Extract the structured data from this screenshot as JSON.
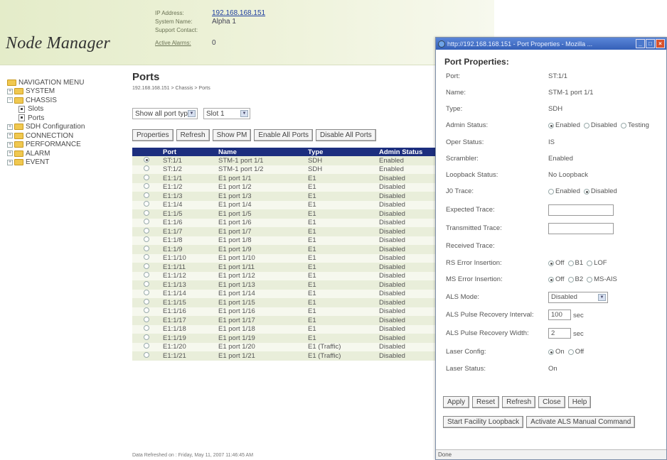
{
  "header": {
    "logo": "Node Manager",
    "ip_label": "IP Address:",
    "ip_value": "192.168.168.151",
    "sysname_label": "System Name:",
    "sysname_value": "Alpha 1",
    "support_label": "Support Contact:",
    "support_value": "",
    "alarms_label": "Active Alarms:",
    "alarms_value": "0"
  },
  "nav": {
    "items": [
      {
        "label": "NAVIGATION MENU"
      },
      {
        "label": "SYSTEM"
      },
      {
        "label": "CHASSIS"
      },
      {
        "label": "Slots"
      },
      {
        "label": "Ports"
      },
      {
        "label": "SDH Configuration"
      },
      {
        "label": "CONNECTION"
      },
      {
        "label": "PERFORMANCE"
      },
      {
        "label": "ALARM"
      },
      {
        "label": "EVENT"
      }
    ]
  },
  "main": {
    "title": "Ports",
    "breadcrumb": "192.168.168.151 > Chassis > Ports",
    "filter_porttype": "Show all port types",
    "filter_slot": "Slot 1",
    "buttons": {
      "properties": "Properties",
      "refresh": "Refresh",
      "show_pm": "Show PM",
      "enable_all": "Enable All Ports",
      "disable_all": "Disable All Ports"
    },
    "table": {
      "columns": [
        "",
        "Port",
        "Name",
        "Type",
        "Admin Status"
      ],
      "rows": [
        {
          "port": "ST:1/1",
          "name": "STM-1 port 1/1",
          "type": "SDH",
          "status": "Enabled",
          "selected": true
        },
        {
          "port": "ST:1/2",
          "name": "STM-1 port 1/2",
          "type": "SDH",
          "status": "Enabled"
        },
        {
          "port": "E1:1/1",
          "name": "E1 port 1/1",
          "type": "E1",
          "status": "Disabled"
        },
        {
          "port": "E1:1/2",
          "name": "E1 port 1/2",
          "type": "E1",
          "status": "Disabled"
        },
        {
          "port": "E1:1/3",
          "name": "E1 port 1/3",
          "type": "E1",
          "status": "Disabled"
        },
        {
          "port": "E1:1/4",
          "name": "E1 port 1/4",
          "type": "E1",
          "status": "Disabled"
        },
        {
          "port": "E1:1/5",
          "name": "E1 port 1/5",
          "type": "E1",
          "status": "Disabled"
        },
        {
          "port": "E1:1/6",
          "name": "E1 port 1/6",
          "type": "E1",
          "status": "Disabled"
        },
        {
          "port": "E1:1/7",
          "name": "E1 port 1/7",
          "type": "E1",
          "status": "Disabled"
        },
        {
          "port": "E1:1/8",
          "name": "E1 port 1/8",
          "type": "E1",
          "status": "Disabled"
        },
        {
          "port": "E1:1/9",
          "name": "E1 port 1/9",
          "type": "E1",
          "status": "Disabled"
        },
        {
          "port": "E1:1/10",
          "name": "E1 port 1/10",
          "type": "E1",
          "status": "Disabled"
        },
        {
          "port": "E1:1/11",
          "name": "E1 port 1/11",
          "type": "E1",
          "status": "Disabled"
        },
        {
          "port": "E1:1/12",
          "name": "E1 port 1/12",
          "type": "E1",
          "status": "Disabled"
        },
        {
          "port": "E1:1/13",
          "name": "E1 port 1/13",
          "type": "E1",
          "status": "Disabled"
        },
        {
          "port": "E1:1/14",
          "name": "E1 port 1/14",
          "type": "E1",
          "status": "Disabled"
        },
        {
          "port": "E1:1/15",
          "name": "E1 port 1/15",
          "type": "E1",
          "status": "Disabled"
        },
        {
          "port": "E1:1/16",
          "name": "E1 port 1/16",
          "type": "E1",
          "status": "Disabled"
        },
        {
          "port": "E1:1/17",
          "name": "E1 port 1/17",
          "type": "E1",
          "status": "Disabled"
        },
        {
          "port": "E1:1/18",
          "name": "E1 port 1/18",
          "type": "E1",
          "status": "Disabled"
        },
        {
          "port": "E1:1/19",
          "name": "E1 port 1/19",
          "type": "E1",
          "status": "Disabled"
        },
        {
          "port": "E1:1/20",
          "name": "E1 port 1/20",
          "type": "E1 (Traffic)",
          "status": "Disabled"
        },
        {
          "port": "E1:1/21",
          "name": "E1 port 1/21",
          "type": "E1 (Traffic)",
          "status": "Disabled"
        }
      ]
    },
    "refreshed": "Data Refreshed on : Friday, May 11, 2007 11:46:45 AM"
  },
  "popup": {
    "window_title": "http://192.168.168.151 - Port Properties - Mozilla ...",
    "heading": "Port Properties:",
    "port_label": "Port:",
    "port_value": "ST:1/1",
    "name_label": "Name:",
    "name_value": "STM-1 port 1/1",
    "type_label": "Type:",
    "type_value": "SDH",
    "admin_label": "Admin Status:",
    "admin_opt1": "Enabled",
    "admin_opt2": "Disabled",
    "admin_opt3": "Testing",
    "oper_label": "Oper Status:",
    "oper_value": "IS",
    "scrambler_label": "Scrambler:",
    "scrambler_value": "Enabled",
    "loopback_label": "Loopback Status:",
    "loopback_value": "No Loopback",
    "j0_label": "J0 Trace:",
    "j0_opt1": "Enabled",
    "j0_opt2": "Disabled",
    "expected_label": "Expected Trace:",
    "transmitted_label": "Transmitted Trace:",
    "received_label": "Received Trace:",
    "rs_label": "RS Error Insertion:",
    "rs_opt1": "Off",
    "rs_opt2": "B1",
    "rs_opt3": "LOF",
    "ms_label": "MS Error Insertion:",
    "ms_opt1": "Off",
    "ms_opt2": "B2",
    "ms_opt3": "MS-AIS",
    "als_label": "ALS Mode:",
    "als_value": "Disabled",
    "pri_label": "ALS Pulse Recovery Interval:",
    "pri_value": "100",
    "pri_unit": "sec",
    "prw_label": "ALS Pulse Recovery Width:",
    "prw_value": "2",
    "prw_unit": "sec",
    "laser_cfg_label": "Laser Config:",
    "laser_opt1": "On",
    "laser_opt2": "Off",
    "laser_status_label": "Laser Status:",
    "laser_status_value": "On",
    "btn_apply": "Apply",
    "btn_reset": "Reset",
    "btn_refresh": "Refresh",
    "btn_close": "Close",
    "btn_help": "Help",
    "btn_loopback": "Start Facility Loopback",
    "btn_als_cmd": "Activate ALS Manual Command",
    "status": "Done"
  }
}
